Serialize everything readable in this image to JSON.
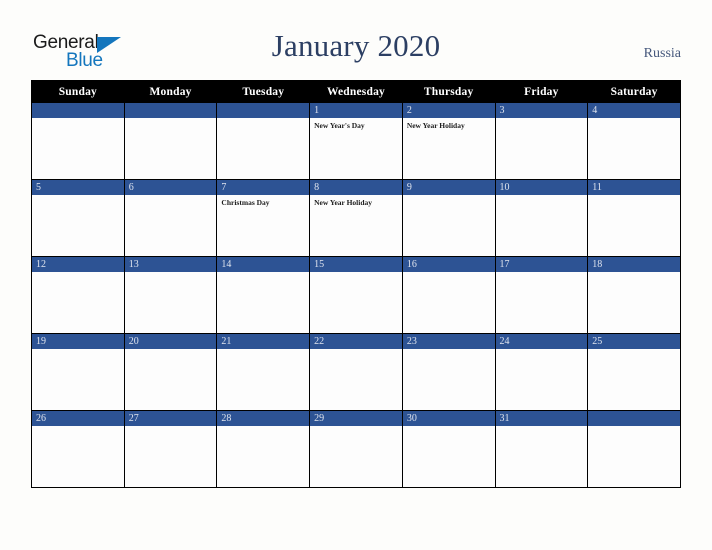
{
  "branding": {
    "logo_line1": "General",
    "logo_line2": "Blue",
    "logo_triangle_icon": "triangle-icon",
    "logo_color_primary": "#1476bd",
    "logo_color_text": "#1b1b1b"
  },
  "header": {
    "title": "January 2020",
    "country": "Russia",
    "title_color": "#2c3f63"
  },
  "theme": {
    "header_row_bg": "#000000",
    "header_row_text": "#ffffff",
    "date_band_bg": "#2d5394",
    "date_band_text": "#dfe4ee",
    "cell_bg": "#fdfdfd",
    "page_bg": "#fdfdfb",
    "border": "#000000"
  },
  "calendar": {
    "weekday_headers": [
      "Sunday",
      "Monday",
      "Tuesday",
      "Wednesday",
      "Thursday",
      "Friday",
      "Saturday"
    ],
    "weeks": [
      [
        {
          "date": "",
          "event": ""
        },
        {
          "date": "",
          "event": ""
        },
        {
          "date": "",
          "event": ""
        },
        {
          "date": "1",
          "event": "New Year's Day"
        },
        {
          "date": "2",
          "event": "New Year Holiday"
        },
        {
          "date": "3",
          "event": ""
        },
        {
          "date": "4",
          "event": ""
        }
      ],
      [
        {
          "date": "5",
          "event": ""
        },
        {
          "date": "6",
          "event": ""
        },
        {
          "date": "7",
          "event": "Christmas Day"
        },
        {
          "date": "8",
          "event": "New Year Holiday"
        },
        {
          "date": "9",
          "event": ""
        },
        {
          "date": "10",
          "event": ""
        },
        {
          "date": "11",
          "event": ""
        }
      ],
      [
        {
          "date": "12",
          "event": ""
        },
        {
          "date": "13",
          "event": ""
        },
        {
          "date": "14",
          "event": ""
        },
        {
          "date": "15",
          "event": ""
        },
        {
          "date": "16",
          "event": ""
        },
        {
          "date": "17",
          "event": ""
        },
        {
          "date": "18",
          "event": ""
        }
      ],
      [
        {
          "date": "19",
          "event": ""
        },
        {
          "date": "20",
          "event": ""
        },
        {
          "date": "21",
          "event": ""
        },
        {
          "date": "22",
          "event": ""
        },
        {
          "date": "23",
          "event": ""
        },
        {
          "date": "24",
          "event": ""
        },
        {
          "date": "25",
          "event": ""
        }
      ],
      [
        {
          "date": "26",
          "event": ""
        },
        {
          "date": "27",
          "event": ""
        },
        {
          "date": "28",
          "event": ""
        },
        {
          "date": "29",
          "event": ""
        },
        {
          "date": "30",
          "event": ""
        },
        {
          "date": "31",
          "event": ""
        },
        {
          "date": "",
          "event": ""
        }
      ]
    ]
  }
}
